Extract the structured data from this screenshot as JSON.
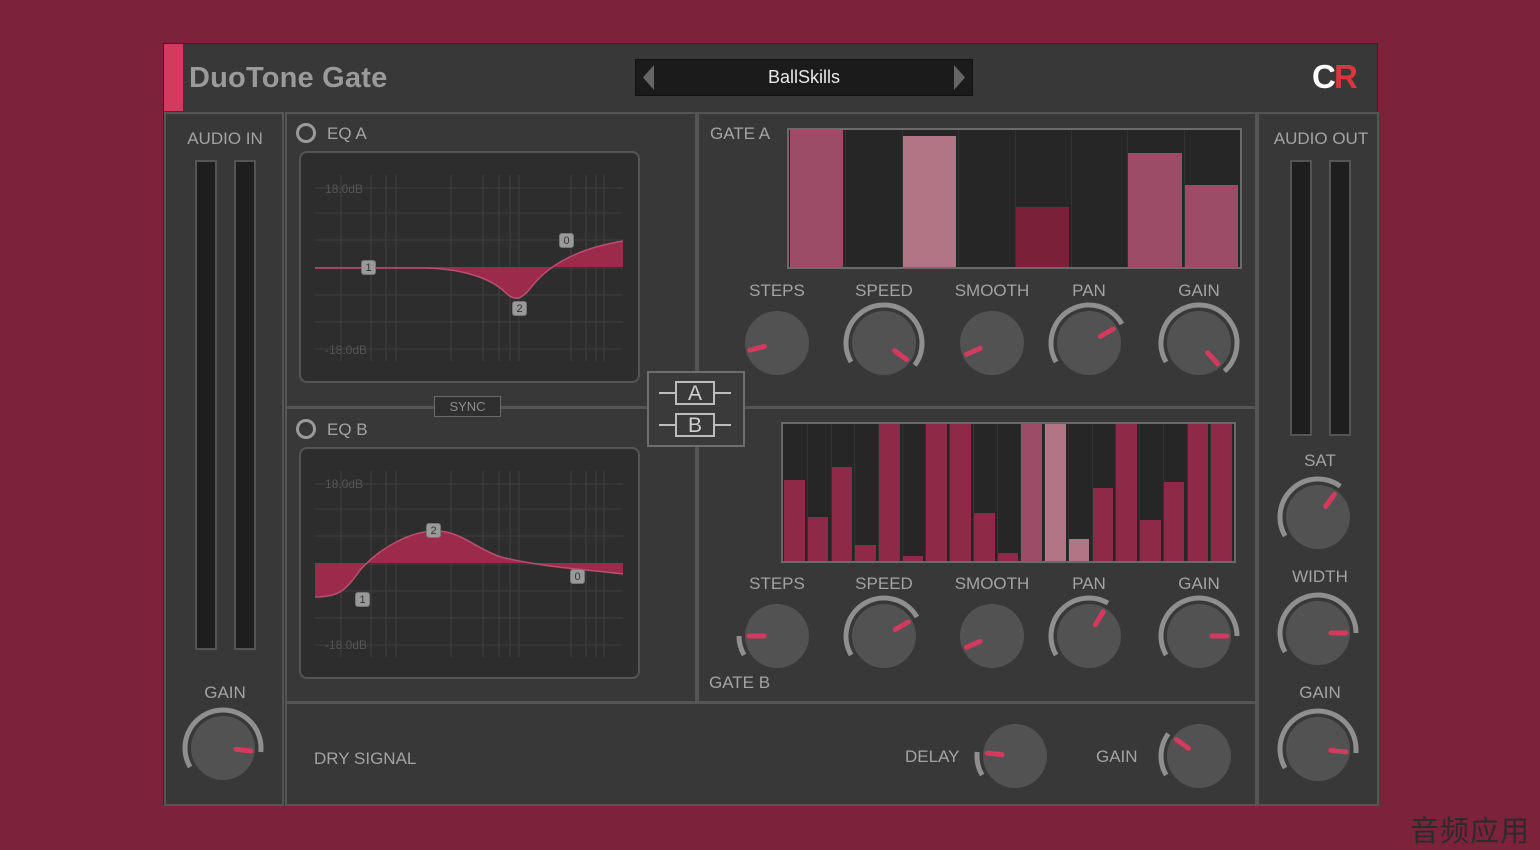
{
  "header": {
    "title": "DuoTone Gate",
    "preset_name": "BallSkills",
    "logo_letters": [
      "C",
      "R"
    ],
    "logo_colors": [
      "#ffffff",
      "#d9363e"
    ]
  },
  "colors": {
    "accent": "#d33a5e",
    "bar_dark": "#7a2038",
    "bar_mid": "#8e2a48",
    "bar_light": "#9c4c66",
    "bar_pale": "#b27585"
  },
  "audio_in": {
    "label": "AUDIO IN",
    "gain_label": "GAIN",
    "gain_value": 0.72
  },
  "audio_out": {
    "label": "AUDIO OUT",
    "sat_label": "SAT",
    "sat_value": 0.52,
    "width_label": "WIDTH",
    "width_value": 0.7,
    "gain_label": "GAIN",
    "gain_value": 0.72
  },
  "eq_a": {
    "title": "EQ A",
    "top_db": "18.0dB",
    "bottom_db": "-18.0dB",
    "nodes": [
      "1",
      "2",
      "0"
    ]
  },
  "eq_b": {
    "title": "EQ B",
    "top_db": "18.0dB",
    "bottom_db": "-18.0dB",
    "nodes": [
      "2",
      "1",
      "0"
    ]
  },
  "sync_label": "SYNC",
  "ab_switch": {
    "a": "A",
    "b": "B"
  },
  "gate_a": {
    "title": "GATE A",
    "steps": [
      {
        "level": 1.0,
        "tone": "light"
      },
      {
        "level": 0.0,
        "tone": "dark"
      },
      {
        "level": 0.96,
        "tone": "pale"
      },
      {
        "level": 0.0,
        "tone": "dark"
      },
      {
        "level": 0.44,
        "tone": "dark"
      },
      {
        "level": 0.0,
        "tone": "dark"
      },
      {
        "level": 0.83,
        "tone": "light"
      },
      {
        "level": 0.6,
        "tone": "light"
      }
    ],
    "knobs": [
      {
        "label": "STEPS",
        "value": 0.05,
        "ring": false
      },
      {
        "label": "SPEED",
        "value": 0.82,
        "ring": true
      },
      {
        "label": "SMOOTH",
        "value": 0.02,
        "ring": false
      },
      {
        "label": "PAN",
        "value": 0.6,
        "ring": true
      },
      {
        "label": "GAIN",
        "value": 0.86,
        "ring": true
      }
    ]
  },
  "gate_b": {
    "title": "GATE B",
    "steps": [
      {
        "level": 0.59,
        "tone": "mid"
      },
      {
        "level": 0.32,
        "tone": "mid"
      },
      {
        "level": 0.69,
        "tone": "mid"
      },
      {
        "level": 0.12,
        "tone": "mid"
      },
      {
        "level": 1.0,
        "tone": "mid"
      },
      {
        "level": 0.04,
        "tone": "mid"
      },
      {
        "level": 1.0,
        "tone": "mid"
      },
      {
        "level": 1.0,
        "tone": "mid"
      },
      {
        "level": 0.35,
        "tone": "mid"
      },
      {
        "level": 0.06,
        "tone": "mid"
      },
      {
        "level": 1.0,
        "tone": "light"
      },
      {
        "level": 1.0,
        "tone": "pale"
      },
      {
        "level": 0.16,
        "tone": "pale"
      },
      {
        "level": 0.53,
        "tone": "mid"
      },
      {
        "level": 1.0,
        "tone": "mid"
      },
      {
        "level": 0.3,
        "tone": "mid"
      },
      {
        "level": 0.58,
        "tone": "mid"
      },
      {
        "level": 1.0,
        "tone": "mid"
      },
      {
        "level": 1.0,
        "tone": "mid"
      }
    ],
    "knobs": [
      {
        "label": "STEPS",
        "value": 0.1,
        "ring": true
      },
      {
        "label": "SPEED",
        "value": 0.6,
        "ring": true
      },
      {
        "label": "SMOOTH",
        "value": 0.02,
        "ring": false
      },
      {
        "label": "PAN",
        "value": 0.5,
        "ring": true
      },
      {
        "label": "GAIN",
        "value": 0.7,
        "ring": true
      }
    ]
  },
  "dry_signal": {
    "label": "DRY SIGNAL",
    "delay_label": "DELAY",
    "delay_value": 0.12,
    "gain_label": "GAIN",
    "gain_value": 0.22
  },
  "watermark": "音频应用"
}
